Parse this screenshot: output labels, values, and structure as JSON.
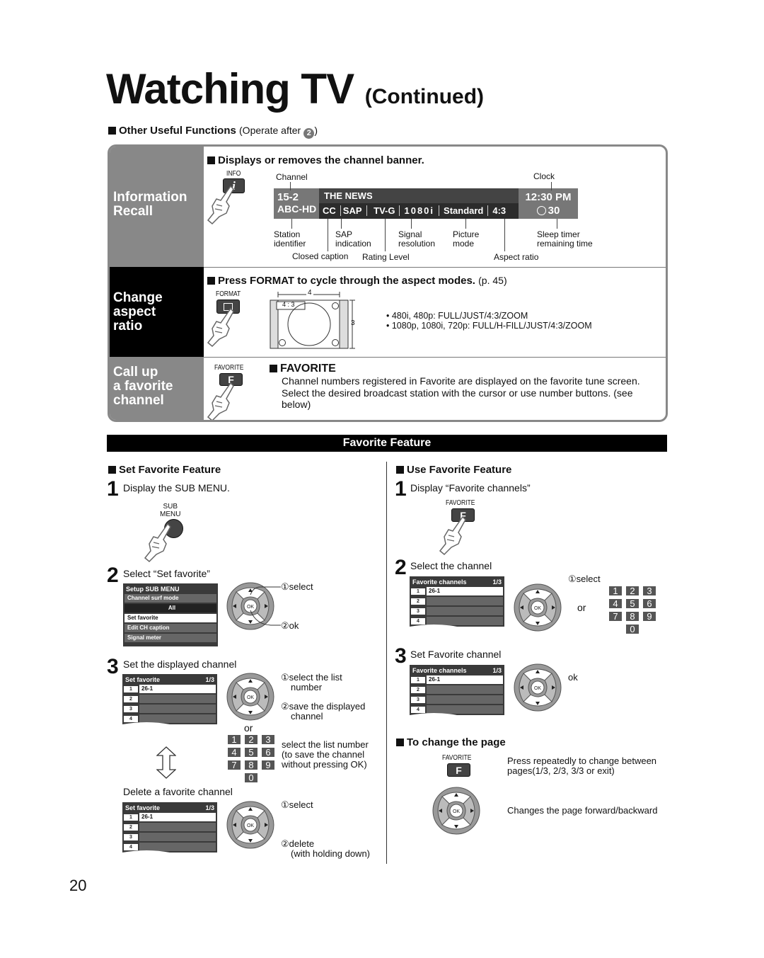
{
  "page": {
    "title": "Watching TV",
    "title_suffix": "(Continued)",
    "page_number": "20"
  },
  "other_functions": {
    "heading": "Other Useful Functions",
    "operate_note": "(Operate after",
    "operate_step": "2",
    "operate_close": ")"
  },
  "info_recall": {
    "side_label_1": "Information",
    "side_label_2": "Recall",
    "heading": "Displays or removes the channel banner.",
    "button_label": "INFO",
    "button_glyph": "i",
    "callouts": {
      "channel": "Channel",
      "clock": "Clock",
      "station_identifier": [
        "Station",
        "identifier"
      ],
      "sap_indication": [
        "SAP",
        "indication"
      ],
      "closed_caption": "Closed caption",
      "rating_level": "Rating Level",
      "signal_resolution": [
        "Signal",
        "resolution"
      ],
      "picture_mode": [
        "Picture",
        "mode"
      ],
      "aspect_ratio": "Aspect ratio",
      "sleep_timer": [
        "Sleep timer",
        "remaining time"
      ]
    },
    "banner": {
      "channel": "15-2",
      "station": "ABC-HD",
      "program": "THE NEWS",
      "cc": "CC",
      "sap": "SAP",
      "rating": "TV-G",
      "resolution": "1080i",
      "picture_mode": "Standard",
      "aspect": "4:3",
      "clock": "12:30 PM",
      "sleep_minutes": "30"
    }
  },
  "aspect": {
    "side_label_1": "Change",
    "side_label_2": "aspect",
    "side_label_3": "ratio",
    "heading": "Press FORMAT to cycle through the aspect modes.",
    "page_ref": "(p. 45)",
    "button_label": "FORMAT",
    "diagram": {
      "width_label": "4",
      "height_label": "3",
      "mode_label": "4 : 3"
    },
    "modes": [
      "• 480i, 480p:  FULL/JUST/4:3/ZOOM",
      "• 1080p, 1080i, 720p:  FULL/H-FILL/JUST/4:3/ZOOM"
    ]
  },
  "favorite_call": {
    "side_label_1": "Call up",
    "side_label_2": "a favorite",
    "side_label_3": "channel",
    "button_label": "FAVORITE",
    "button_glyph": "F",
    "heading": "FAVORITE",
    "body": "Channel numbers registered in Favorite are displayed on the favorite tune screen. Select the desired broadcast station with the cursor or use number buttons. (see below)"
  },
  "favorite_feature": {
    "bar_title": "Favorite Feature",
    "set": {
      "heading": "Set Favorite Feature",
      "step1": {
        "num": "1",
        "text": "Display the SUB MENU.",
        "button_label_1": "SUB",
        "button_label_2": "MENU"
      },
      "step2": {
        "num": "2",
        "text": "Select “Set favorite”",
        "menu": {
          "title": "Setup SUB MENU",
          "items": [
            "Channel surf mode",
            "All",
            "Set favorite",
            "Edit CH caption",
            "Signal meter"
          ]
        },
        "callout_select": "①select",
        "callout_ok": "②ok"
      },
      "step3": {
        "num": "3",
        "text": "Set the displayed channel",
        "menu": {
          "title": "Set favorite",
          "page": "1/3",
          "rows": [
            {
              "n": "1",
              "v": "26-1"
            },
            {
              "n": "2",
              "v": ""
            },
            {
              "n": "3",
              "v": ""
            },
            {
              "n": "4",
              "v": ""
            }
          ]
        },
        "callout_select": "①select the list",
        "callout_select_2": "number",
        "callout_save": "②save the displayed",
        "callout_save_2": "channel",
        "or": "or",
        "numpad_note": [
          "select the list number",
          "(to save the channel",
          "without pressing OK)"
        ]
      },
      "delete": {
        "text": "Delete a favorite channel",
        "menu": {
          "title": "Set favorite",
          "page": "1/3",
          "rows": [
            {
              "n": "1",
              "v": "26-1"
            },
            {
              "n": "2",
              "v": ""
            },
            {
              "n": "3",
              "v": ""
            },
            {
              "n": "4",
              "v": ""
            }
          ]
        },
        "callout_select": "①select",
        "callout_delete": "②delete",
        "callout_delete_2": "(with holding down)"
      }
    },
    "use": {
      "heading": "Use Favorite Feature",
      "step1": {
        "num": "1",
        "text": "Display “Favorite channels”",
        "button_label": "FAVORITE",
        "button_glyph": "F"
      },
      "step2": {
        "num": "2",
        "text": "Select the channel",
        "menu": {
          "title": "Favorite channels",
          "page": "1/3",
          "rows": [
            {
              "n": "1",
              "v": "26-1"
            },
            {
              "n": "2",
              "v": ""
            },
            {
              "n": "3",
              "v": ""
            },
            {
              "n": "4",
              "v": ""
            }
          ]
        },
        "callout_select": "①select",
        "or": "or"
      },
      "step3": {
        "num": "3",
        "text": "Set Favorite channel",
        "menu": {
          "title": "Favorite channels",
          "page": "1/3",
          "rows": [
            {
              "n": "1",
              "v": "26-1"
            },
            {
              "n": "2",
              "v": ""
            },
            {
              "n": "3",
              "v": ""
            },
            {
              "n": "4",
              "v": ""
            }
          ]
        },
        "callout_ok": "ok"
      },
      "change_page": {
        "heading": "To change the page",
        "button_label": "FAVORITE",
        "button_glyph": "F",
        "favorite_note_1": "Press repeatedly to change between",
        "favorite_note_2": "pages(1/3, 2/3, 3/3 or exit)",
        "dpad_note": "Changes the page forward/backward"
      }
    },
    "numpad_keys": [
      "1",
      "2",
      "3",
      "4",
      "5",
      "6",
      "7",
      "8",
      "9",
      "0"
    ],
    "ok_label": "OK"
  }
}
